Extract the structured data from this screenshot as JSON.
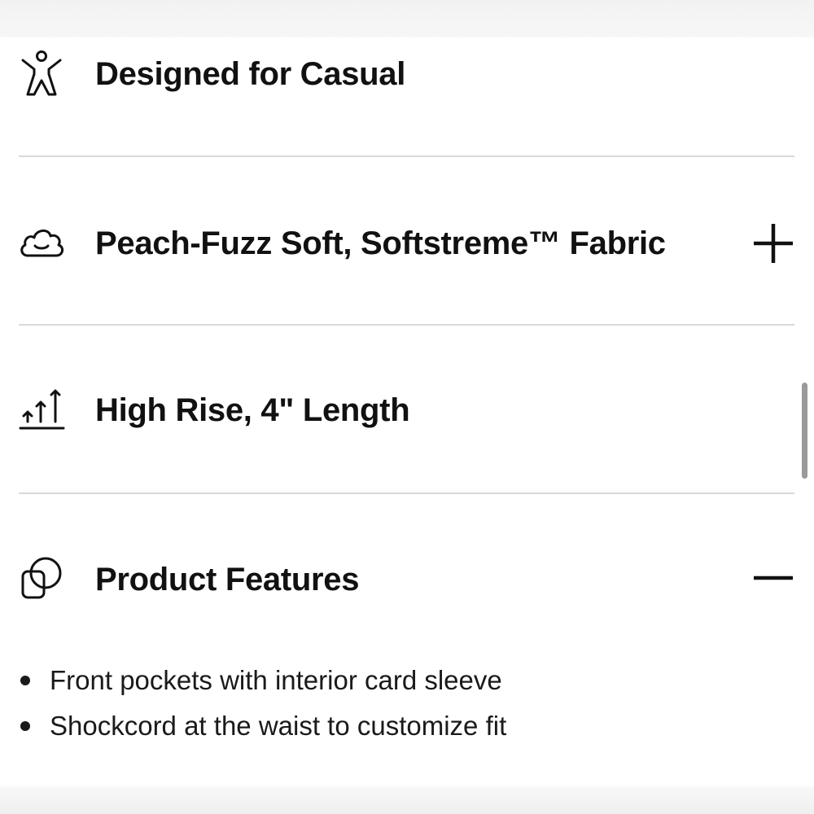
{
  "rows": [
    {
      "icon": "person-arms-raised-icon",
      "title": "Designed for Casual"
    },
    {
      "icon": "cloud-icon",
      "title": "Peach-Fuzz Soft, Softstreme™ Fabric",
      "toggle": "plus-icon"
    },
    {
      "icon": "rising-arrows-icon",
      "title": "High Rise, 4\" Length"
    },
    {
      "icon": "overlapping-shapes-icon",
      "title": "Product Features",
      "toggle": "minus-icon"
    }
  ],
  "features": [
    "Front pockets with interior card sleeve",
    "Shockcord at the waist to customize fit"
  ],
  "colors": {
    "text": "#111111",
    "divider": "#d9d9d9",
    "background": "#ffffff",
    "scrollbar": "#9a9a9a"
  }
}
